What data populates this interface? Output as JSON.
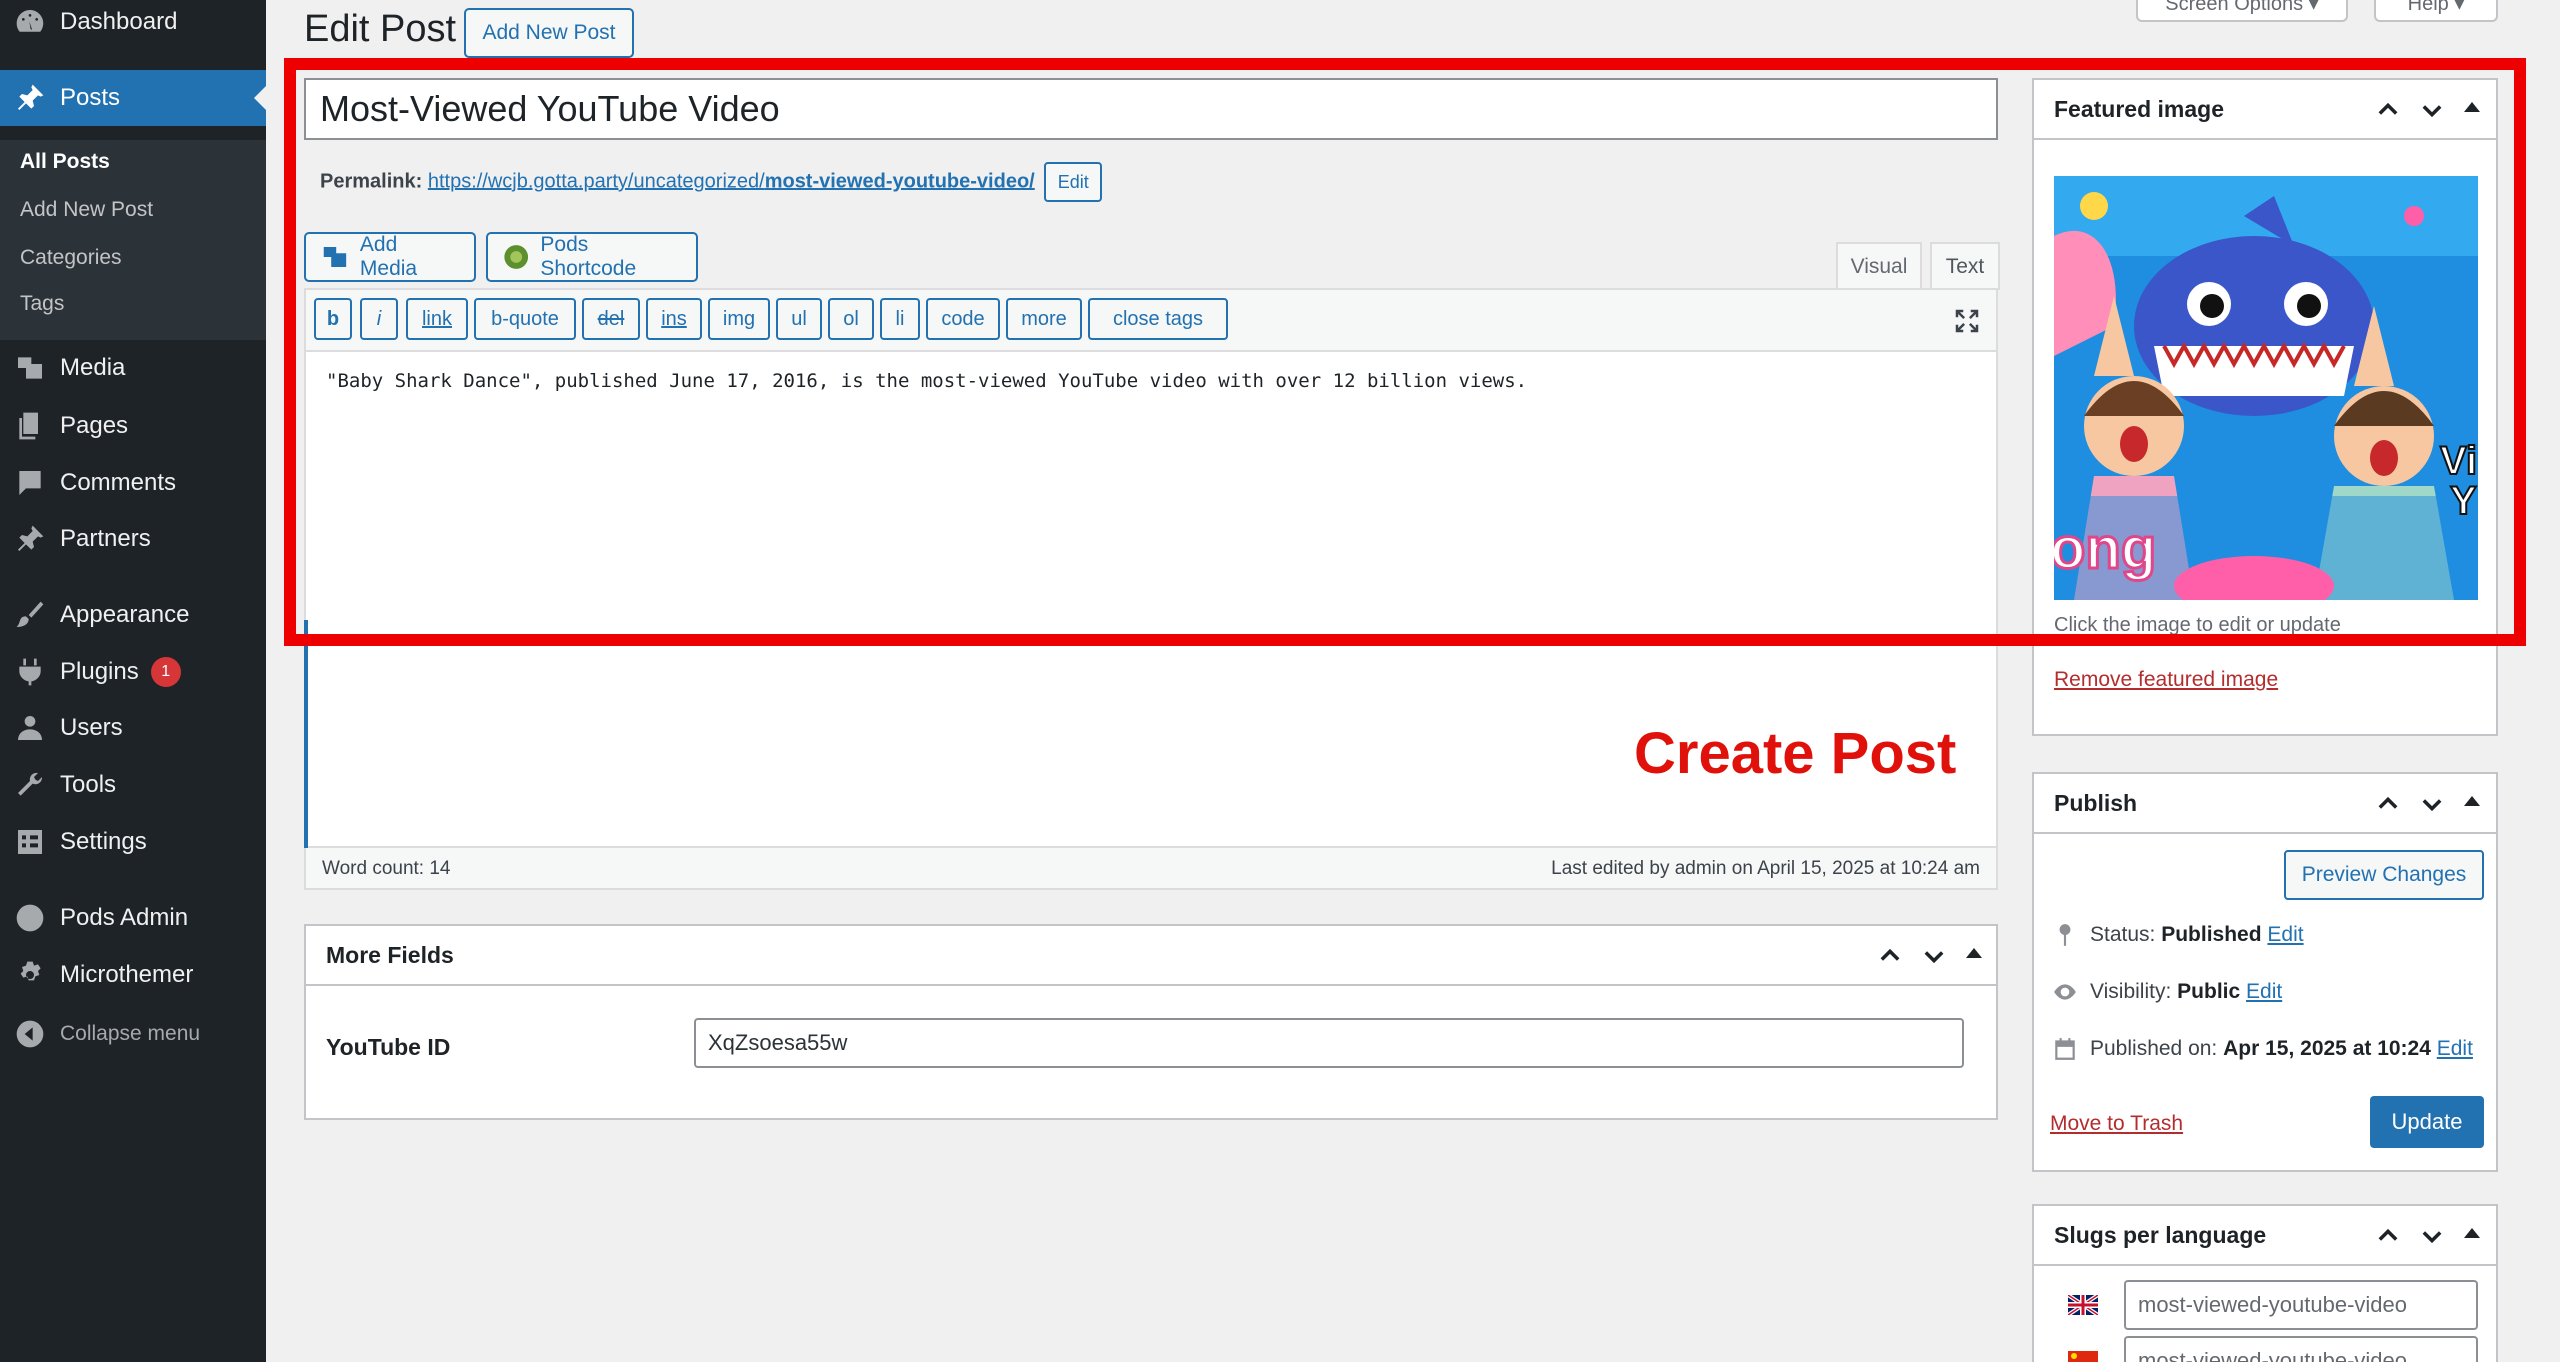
{
  "sidebar": {
    "dashboard": "Dashboard",
    "posts": "Posts",
    "submenu": [
      "All Posts",
      "Add New Post",
      "Categories",
      "Tags"
    ],
    "media": "Media",
    "pages": "Pages",
    "comments": "Comments",
    "partners": "Partners",
    "appearance": "Appearance",
    "plugins": "Plugins",
    "plugins_badge": "1",
    "users": "Users",
    "tools": "Tools",
    "settings": "Settings",
    "pods_admin": "Pods Admin",
    "microthemer": "Microthemer",
    "collapse": "Collapse menu"
  },
  "header": {
    "title": "Edit Post",
    "add_new": "Add New Post",
    "screen_options": "Screen Options",
    "help": "Help"
  },
  "post": {
    "title": "Most-Viewed YouTube Video",
    "permalink_label": "Permalink:",
    "permalink_base": "https://wcjb.gotta.party/uncategorized/",
    "permalink_slug": "most-viewed-youtube-video/",
    "permalink_edit": "Edit",
    "add_media": "Add Media",
    "pods_shortcode": "Pods Shortcode",
    "tab_visual": "Visual",
    "tab_text": "Text",
    "quicktags": [
      "b",
      "i",
      "link",
      "b-quote",
      "del",
      "ins",
      "img",
      "ul",
      "ol",
      "li",
      "code",
      "more",
      "close tags"
    ],
    "content": "\"Baby Shark Dance\", published June 17, 2016, is the most-viewed YouTube video with over 12 billion views.",
    "word_count": "Word count: 14",
    "last_edited": "Last edited by admin on April 15, 2025 at 10:24 am"
  },
  "annotation": {
    "label": "Create Post",
    "color": "#ee0000"
  },
  "more_fields": {
    "title": "More Fields",
    "youtube_label": "YouTube ID",
    "youtube_value": "XqZsoesa55w"
  },
  "featured_image": {
    "title": "Featured image",
    "hint": "Click the image to edit or update",
    "remove": "Remove featured image",
    "thumb_text_1": "ong",
    "thumb_text_2": "Vi",
    "thumb_text_3": "Y"
  },
  "publish": {
    "title": "Publish",
    "preview": "Preview Changes",
    "status_label": "Status:",
    "status_value": "Published",
    "visibility_label": "Visibility:",
    "visibility_value": "Public",
    "published_label": "Published on:",
    "published_value": "Apr 15, 2025 at 10:24",
    "edit": "Edit",
    "trash": "Move to Trash",
    "update": "Update"
  },
  "slugs": {
    "title": "Slugs per language",
    "values": [
      "most-viewed-youtube-video",
      "most-viewed-youtube-video"
    ]
  },
  "colors": {
    "accent": "#2271b1",
    "sidebar": "#1d2327",
    "danger": "#b32d2e"
  }
}
